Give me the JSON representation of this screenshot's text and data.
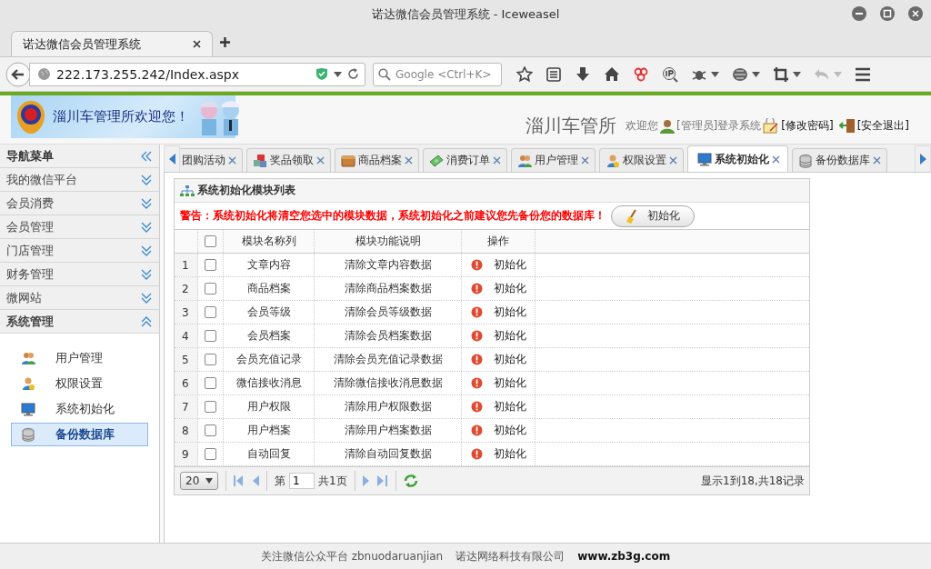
{
  "window": {
    "title": "诺达微信会员管理系统 - Iceweasel"
  },
  "browser_tabs": [
    {
      "label": "诺达微信会员管理系统",
      "selected": true
    }
  ],
  "address_bar": {
    "value": "222.173.255.242/Index.aspx"
  },
  "search_field": {
    "placeholder": "Google <Ctrl+K>"
  },
  "header": {
    "banner_text": "淄川车管理所欢迎您！",
    "site_name": "淄川车管所",
    "welcome": "欢迎您",
    "user": "[管理员]登录系统",
    "links": [
      {
        "label": "[修改密码]",
        "kind": "password"
      },
      {
        "label": "[安全退出]",
        "kind": "logout"
      }
    ]
  },
  "sidebar": {
    "title": "导航菜单",
    "sections": [
      {
        "label": "我的微信平台",
        "expanded": false
      },
      {
        "label": "会员消费",
        "expanded": false
      },
      {
        "label": "会员管理",
        "expanded": false
      },
      {
        "label": "门店管理",
        "expanded": false
      },
      {
        "label": "财务管理",
        "expanded": false
      },
      {
        "label": "微网站",
        "expanded": false
      },
      {
        "label": "系统管理",
        "expanded": true,
        "children": [
          {
            "label": "用户管理",
            "kind": "users",
            "selected": false
          },
          {
            "label": "权限设置",
            "kind": "key",
            "selected": false
          },
          {
            "label": "系统初始化",
            "kind": "monitor",
            "selected": false
          },
          {
            "label": "备份数据库",
            "kind": "database",
            "selected": true
          }
        ]
      }
    ]
  },
  "tabs": [
    {
      "label": "团购活动",
      "kind": "none",
      "selected": false
    },
    {
      "label": "奖品领取",
      "kind": "cubes",
      "selected": false
    },
    {
      "label": "商品档案",
      "kind": "box",
      "selected": false
    },
    {
      "label": "消费订单",
      "kind": "money",
      "selected": false
    },
    {
      "label": "用户管理",
      "kind": "users",
      "selected": false
    },
    {
      "label": "权限设置",
      "kind": "key",
      "selected": false
    },
    {
      "label": "系统初始化",
      "kind": "monitor",
      "selected": true
    },
    {
      "label": "备份数据库",
      "kind": "database",
      "selected": false
    }
  ],
  "panel": {
    "title": "系统初始化模块列表",
    "warning": "警告：系统初始化将清空您选中的模块数据，系统初始化之前建议您先备份您的数据库！",
    "init_button": "初始化",
    "columns": [
      "模块名称列",
      "模块功能说明",
      "操作"
    ],
    "select_all": false,
    "rows": [
      {
        "index": "1",
        "name": "文章内容",
        "description": "清除文章内容数据",
        "action": "初始化",
        "checked": false
      },
      {
        "index": "2",
        "name": "商品档案",
        "description": "清除商品档案数据",
        "action": "初始化",
        "checked": false
      },
      {
        "index": "3",
        "name": "会员等级",
        "description": "清除会员等级数据",
        "action": "初始化",
        "checked": false
      },
      {
        "index": "4",
        "name": "会员档案",
        "description": "清除会员档案数据",
        "action": "初始化",
        "checked": false
      },
      {
        "index": "5",
        "name": "会员充值记录",
        "description": "清除会员充值记录数据",
        "action": "初始化",
        "checked": false
      },
      {
        "index": "6",
        "name": "微信接收消息",
        "description": "清除微信接收消息数据",
        "action": "初始化",
        "checked": false
      },
      {
        "index": "7",
        "name": "用户权限",
        "description": "清除用户权限数据",
        "action": "初始化",
        "checked": false
      },
      {
        "index": "8",
        "name": "用户档案",
        "description": "清除用户档案数据",
        "action": "初始化",
        "checked": false
      },
      {
        "index": "9",
        "name": "自动回复",
        "description": "清除自动回复数据",
        "action": "初始化",
        "checked": false
      }
    ],
    "pager": {
      "page_size": "20",
      "page_prefix": "第",
      "page": "1",
      "page_suffix": "共1页",
      "summary": "显示1到18,共18记录"
    }
  },
  "footer": {
    "items": [
      {
        "text": "关注微信公众平台 zbnuodaruanjian",
        "bold": false
      },
      {
        "text": "诺达网络科技有限公司",
        "bold": false
      },
      {
        "text": "www.zb3g.com",
        "bold": true
      }
    ]
  }
}
